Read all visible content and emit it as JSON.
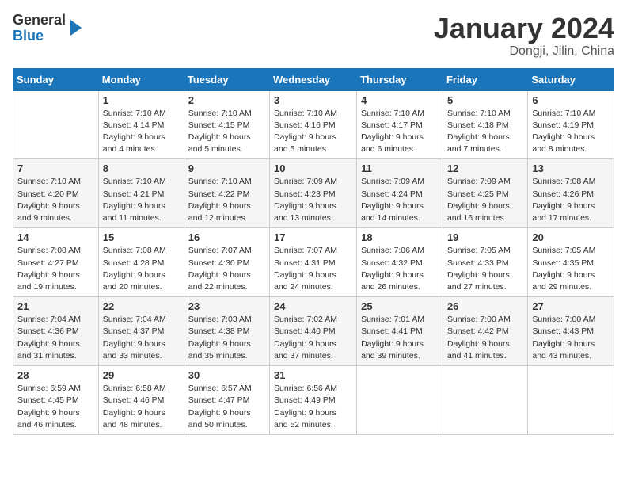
{
  "logo": {
    "line1": "General",
    "line2": "Blue"
  },
  "header": {
    "month": "January 2024",
    "location": "Dongji, Jilin, China"
  },
  "weekdays": [
    "Sunday",
    "Monday",
    "Tuesday",
    "Wednesday",
    "Thursday",
    "Friday",
    "Saturday"
  ],
  "weeks": [
    [
      {
        "num": "",
        "sunrise": "",
        "sunset": "",
        "daylight": ""
      },
      {
        "num": "1",
        "sunrise": "Sunrise: 7:10 AM",
        "sunset": "Sunset: 4:14 PM",
        "daylight": "Daylight: 9 hours and 4 minutes."
      },
      {
        "num": "2",
        "sunrise": "Sunrise: 7:10 AM",
        "sunset": "Sunset: 4:15 PM",
        "daylight": "Daylight: 9 hours and 5 minutes."
      },
      {
        "num": "3",
        "sunrise": "Sunrise: 7:10 AM",
        "sunset": "Sunset: 4:16 PM",
        "daylight": "Daylight: 9 hours and 5 minutes."
      },
      {
        "num": "4",
        "sunrise": "Sunrise: 7:10 AM",
        "sunset": "Sunset: 4:17 PM",
        "daylight": "Daylight: 9 hours and 6 minutes."
      },
      {
        "num": "5",
        "sunrise": "Sunrise: 7:10 AM",
        "sunset": "Sunset: 4:18 PM",
        "daylight": "Daylight: 9 hours and 7 minutes."
      },
      {
        "num": "6",
        "sunrise": "Sunrise: 7:10 AM",
        "sunset": "Sunset: 4:19 PM",
        "daylight": "Daylight: 9 hours and 8 minutes."
      }
    ],
    [
      {
        "num": "7",
        "sunrise": "Sunrise: 7:10 AM",
        "sunset": "Sunset: 4:20 PM",
        "daylight": "Daylight: 9 hours and 9 minutes."
      },
      {
        "num": "8",
        "sunrise": "Sunrise: 7:10 AM",
        "sunset": "Sunset: 4:21 PM",
        "daylight": "Daylight: 9 hours and 11 minutes."
      },
      {
        "num": "9",
        "sunrise": "Sunrise: 7:10 AM",
        "sunset": "Sunset: 4:22 PM",
        "daylight": "Daylight: 9 hours and 12 minutes."
      },
      {
        "num": "10",
        "sunrise": "Sunrise: 7:09 AM",
        "sunset": "Sunset: 4:23 PM",
        "daylight": "Daylight: 9 hours and 13 minutes."
      },
      {
        "num": "11",
        "sunrise": "Sunrise: 7:09 AM",
        "sunset": "Sunset: 4:24 PM",
        "daylight": "Daylight: 9 hours and 14 minutes."
      },
      {
        "num": "12",
        "sunrise": "Sunrise: 7:09 AM",
        "sunset": "Sunset: 4:25 PM",
        "daylight": "Daylight: 9 hours and 16 minutes."
      },
      {
        "num": "13",
        "sunrise": "Sunrise: 7:08 AM",
        "sunset": "Sunset: 4:26 PM",
        "daylight": "Daylight: 9 hours and 17 minutes."
      }
    ],
    [
      {
        "num": "14",
        "sunrise": "Sunrise: 7:08 AM",
        "sunset": "Sunset: 4:27 PM",
        "daylight": "Daylight: 9 hours and 19 minutes."
      },
      {
        "num": "15",
        "sunrise": "Sunrise: 7:08 AM",
        "sunset": "Sunset: 4:28 PM",
        "daylight": "Daylight: 9 hours and 20 minutes."
      },
      {
        "num": "16",
        "sunrise": "Sunrise: 7:07 AM",
        "sunset": "Sunset: 4:30 PM",
        "daylight": "Daylight: 9 hours and 22 minutes."
      },
      {
        "num": "17",
        "sunrise": "Sunrise: 7:07 AM",
        "sunset": "Sunset: 4:31 PM",
        "daylight": "Daylight: 9 hours and 24 minutes."
      },
      {
        "num": "18",
        "sunrise": "Sunrise: 7:06 AM",
        "sunset": "Sunset: 4:32 PM",
        "daylight": "Daylight: 9 hours and 26 minutes."
      },
      {
        "num": "19",
        "sunrise": "Sunrise: 7:05 AM",
        "sunset": "Sunset: 4:33 PM",
        "daylight": "Daylight: 9 hours and 27 minutes."
      },
      {
        "num": "20",
        "sunrise": "Sunrise: 7:05 AM",
        "sunset": "Sunset: 4:35 PM",
        "daylight": "Daylight: 9 hours and 29 minutes."
      }
    ],
    [
      {
        "num": "21",
        "sunrise": "Sunrise: 7:04 AM",
        "sunset": "Sunset: 4:36 PM",
        "daylight": "Daylight: 9 hours and 31 minutes."
      },
      {
        "num": "22",
        "sunrise": "Sunrise: 7:04 AM",
        "sunset": "Sunset: 4:37 PM",
        "daylight": "Daylight: 9 hours and 33 minutes."
      },
      {
        "num": "23",
        "sunrise": "Sunrise: 7:03 AM",
        "sunset": "Sunset: 4:38 PM",
        "daylight": "Daylight: 9 hours and 35 minutes."
      },
      {
        "num": "24",
        "sunrise": "Sunrise: 7:02 AM",
        "sunset": "Sunset: 4:40 PM",
        "daylight": "Daylight: 9 hours and 37 minutes."
      },
      {
        "num": "25",
        "sunrise": "Sunrise: 7:01 AM",
        "sunset": "Sunset: 4:41 PM",
        "daylight": "Daylight: 9 hours and 39 minutes."
      },
      {
        "num": "26",
        "sunrise": "Sunrise: 7:00 AM",
        "sunset": "Sunset: 4:42 PM",
        "daylight": "Daylight: 9 hours and 41 minutes."
      },
      {
        "num": "27",
        "sunrise": "Sunrise: 7:00 AM",
        "sunset": "Sunset: 4:43 PM",
        "daylight": "Daylight: 9 hours and 43 minutes."
      }
    ],
    [
      {
        "num": "28",
        "sunrise": "Sunrise: 6:59 AM",
        "sunset": "Sunset: 4:45 PM",
        "daylight": "Daylight: 9 hours and 46 minutes."
      },
      {
        "num": "29",
        "sunrise": "Sunrise: 6:58 AM",
        "sunset": "Sunset: 4:46 PM",
        "daylight": "Daylight: 9 hours and 48 minutes."
      },
      {
        "num": "30",
        "sunrise": "Sunrise: 6:57 AM",
        "sunset": "Sunset: 4:47 PM",
        "daylight": "Daylight: 9 hours and 50 minutes."
      },
      {
        "num": "31",
        "sunrise": "Sunrise: 6:56 AM",
        "sunset": "Sunset: 4:49 PM",
        "daylight": "Daylight: 9 hours and 52 minutes."
      },
      {
        "num": "",
        "sunrise": "",
        "sunset": "",
        "daylight": ""
      },
      {
        "num": "",
        "sunrise": "",
        "sunset": "",
        "daylight": ""
      },
      {
        "num": "",
        "sunrise": "",
        "sunset": "",
        "daylight": ""
      }
    ]
  ]
}
